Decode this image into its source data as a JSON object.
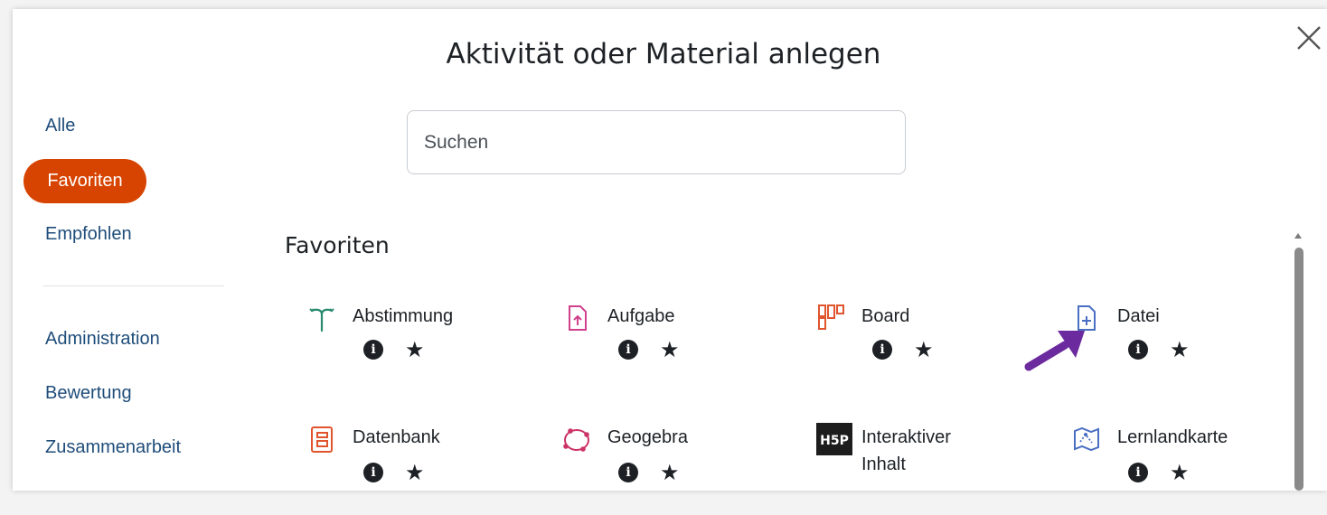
{
  "dialog": {
    "title": "Aktivität oder Material anlegen",
    "close_icon": "close-icon"
  },
  "sidebar": {
    "items": [
      {
        "label": "Alle",
        "active": false
      },
      {
        "label": "Favoriten",
        "active": true
      },
      {
        "label": "Empfohlen",
        "active": false
      },
      {
        "label": "Administration",
        "active": false
      },
      {
        "label": "Bewertung",
        "active": false
      },
      {
        "label": "Zusammenarbeit",
        "active": false
      }
    ],
    "active_color": "#d74300"
  },
  "search": {
    "placeholder": "Suchen"
  },
  "section": {
    "title": "Favoriten"
  },
  "activities": [
    {
      "name": "Abstimmung",
      "icon": "choice-icon",
      "color": "#2a8a6e"
    },
    {
      "name": "Aufgabe",
      "icon": "assignment-icon",
      "color": "#d1408b"
    },
    {
      "name": "Board",
      "icon": "board-icon",
      "color": "#e0542e"
    },
    {
      "name": "Datei",
      "icon": "file-icon",
      "color": "#4a6fc2"
    },
    {
      "name": "Datenbank",
      "icon": "database-icon",
      "color": "#e0542e"
    },
    {
      "name": "Geogebra",
      "icon": "geogebra-icon",
      "color": "#cc3366"
    },
    {
      "name": "Interaktiver Inhalt",
      "icon": "h5p-icon",
      "color": "#1d1d1d",
      "logo_text": "H5P"
    },
    {
      "name": "Lernlandkarte",
      "icon": "map-icon",
      "color": "#4a6fc2"
    }
  ],
  "tile_actions": {
    "info_glyph": "i",
    "star_glyph": "★"
  },
  "annotation": {
    "arrow_color": "#6b2a9e"
  }
}
